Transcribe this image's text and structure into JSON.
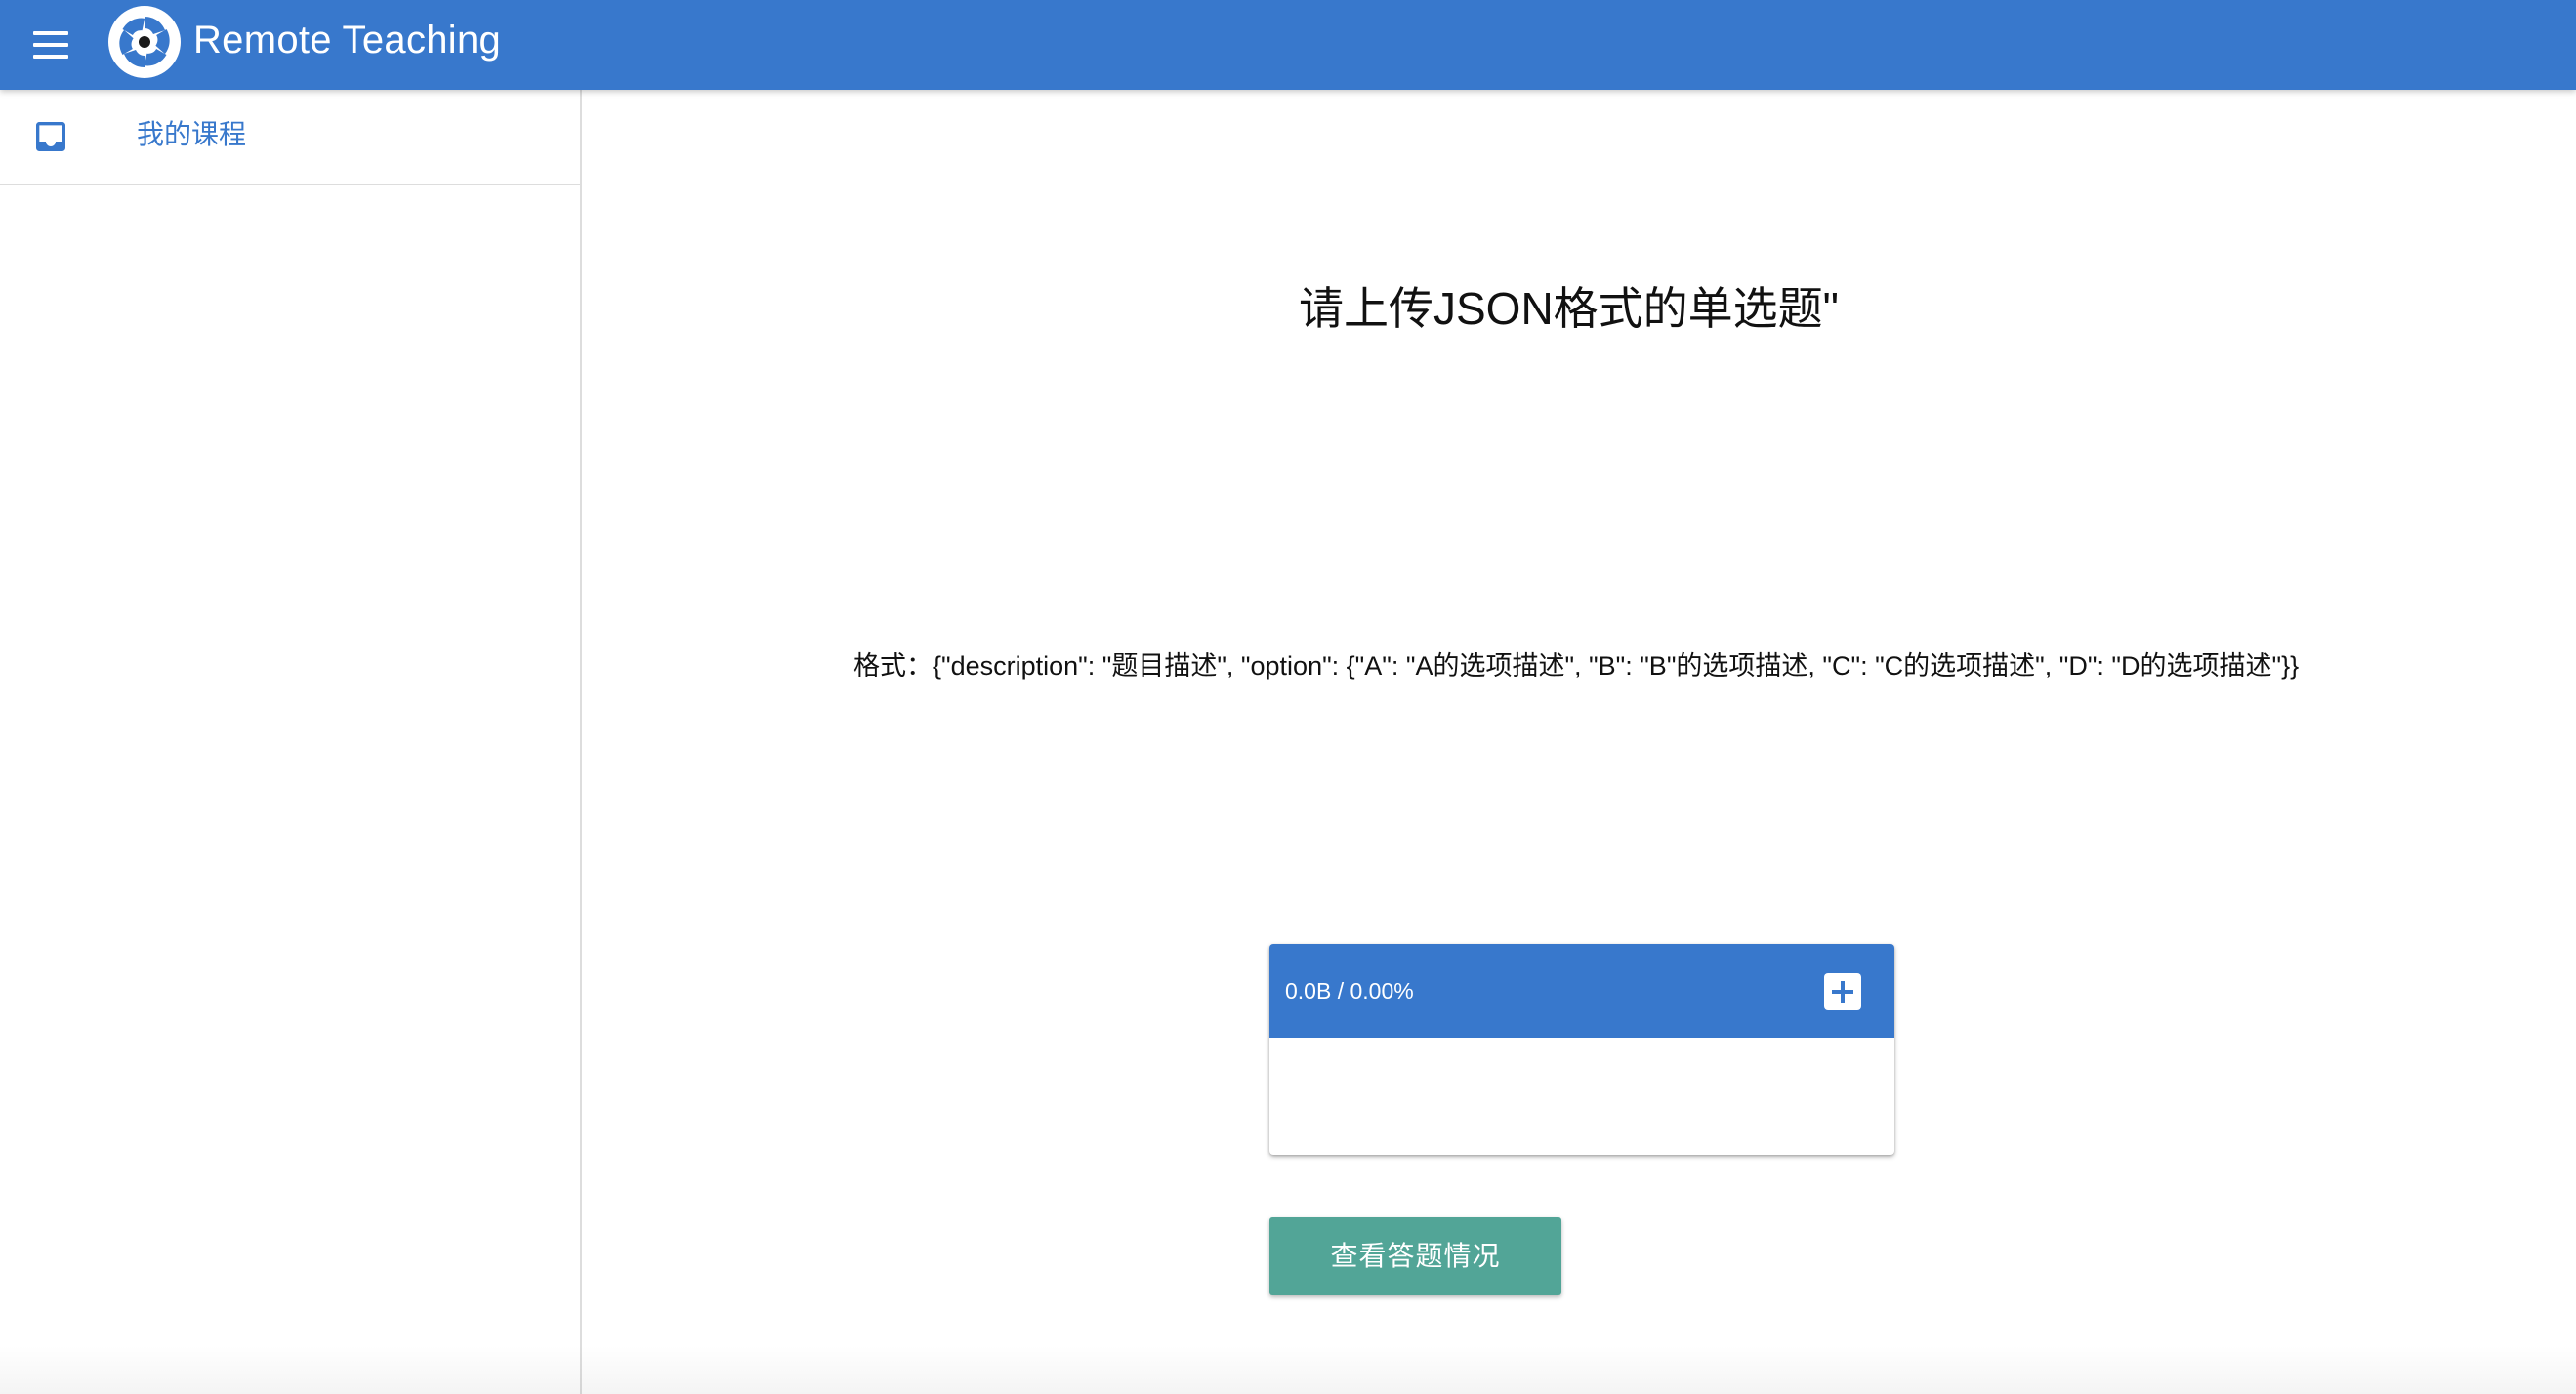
{
  "header": {
    "menu_icon": "menu-icon",
    "logo_icon": "app-logo",
    "title": "Remote Teaching"
  },
  "sidebar": {
    "items": [
      {
        "label": "我的课程",
        "icon": "inbox-icon"
      }
    ]
  },
  "main": {
    "title": "请上传JSON格式的单选题\"",
    "format_text": "格式：{\"description\": \"题目描述\", \"option\": {\"A\": \"A的选项描述\", \"B\": \"B\"的选项描述, \"C\": \"C的选项描述\", \"D\": \"D的选项描述\"}}",
    "uploader": {
      "status": "0.0B / 0.00%",
      "add_icon": "add-box-icon"
    },
    "view_button": "查看答题情况"
  },
  "colors": {
    "primary": "#3878cc",
    "teal": "#52a597",
    "text": "#111111",
    "divider": "#dddddd"
  }
}
